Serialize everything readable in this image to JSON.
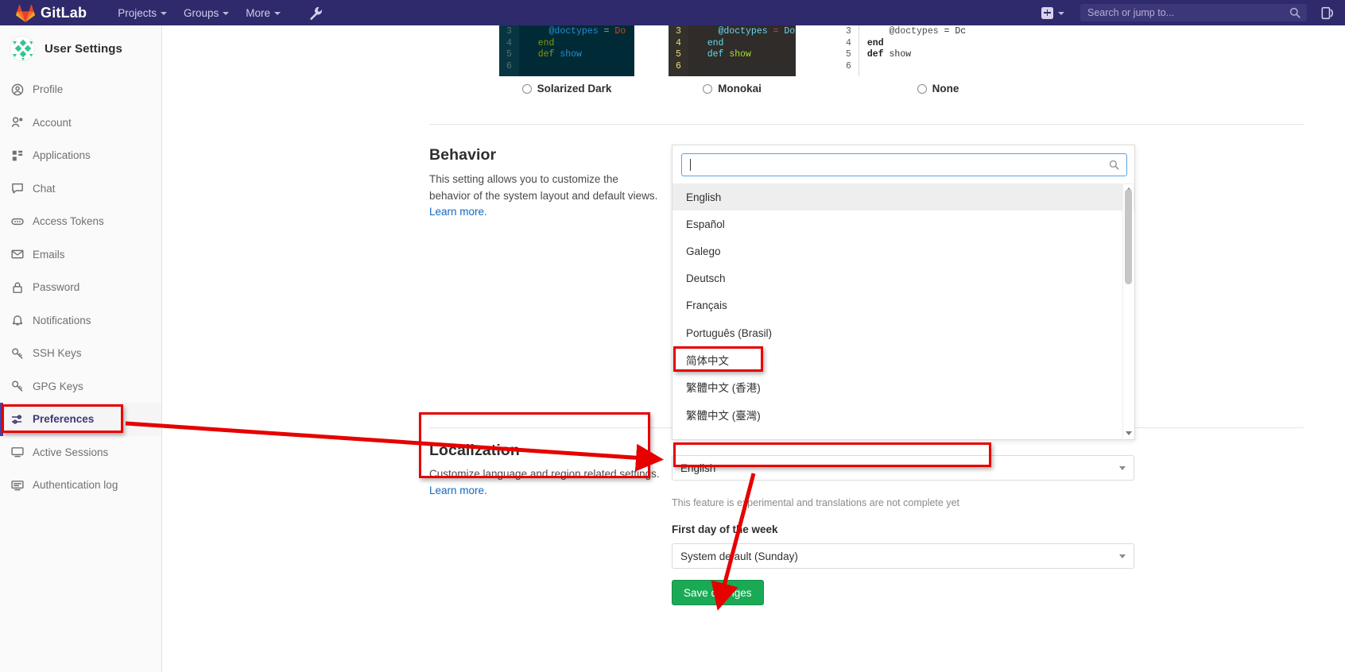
{
  "topnav": {
    "brand": "GitLab",
    "items": [
      {
        "label": "Projects"
      },
      {
        "label": "Groups"
      },
      {
        "label": "More"
      }
    ],
    "wrench_icon": "wrench-icon",
    "plus_icon": "plus-square-icon",
    "search_placeholder": "Search or jump to...",
    "search_icon": "search-icon",
    "user_icon": "user-avatar-icon"
  },
  "sidebar": {
    "title": "User Settings",
    "avatar_icon": "user-avatar-identicon",
    "items": [
      {
        "label": "Profile",
        "icon": "user-circle-icon",
        "active": false
      },
      {
        "label": "Account",
        "icon": "account-icon",
        "active": false
      },
      {
        "label": "Applications",
        "icon": "applications-icon",
        "active": false
      },
      {
        "label": "Chat",
        "icon": "chat-icon",
        "active": false
      },
      {
        "label": "Access Tokens",
        "icon": "token-icon",
        "active": false
      },
      {
        "label": "Emails",
        "icon": "envelope-icon",
        "active": false
      },
      {
        "label": "Password",
        "icon": "lock-icon",
        "active": false
      },
      {
        "label": "Notifications",
        "icon": "bell-icon",
        "active": false
      },
      {
        "label": "SSH Keys",
        "icon": "key-icon",
        "active": false
      },
      {
        "label": "GPG Keys",
        "icon": "key-icon",
        "active": false
      },
      {
        "label": "Preferences",
        "icon": "sliders-icon",
        "active": true
      },
      {
        "label": "Active Sessions",
        "icon": "monitor-icon",
        "active": false
      },
      {
        "label": "Authentication log",
        "icon": "log-icon",
        "active": false
      }
    ]
  },
  "themes": [
    {
      "name": "Solarized Dark",
      "bg": "#002b36",
      "gutter_bg": "#073642",
      "gutter_fg": "#586e75",
      "lines": [
        "3",
        "4",
        "5",
        "6"
      ],
      "code": [
        {
          "indent": "    ",
          "tokens": [
            {
              "t": "@doctypes",
              "c": "#268bd2"
            },
            {
              "t": " = ",
              "c": "#93a1a1"
            },
            {
              "t": "Do",
              "c": "#cb4b16"
            }
          ]
        },
        {
          "indent": "  ",
          "tokens": [
            {
              "t": "end",
              "c": "#859900"
            }
          ]
        },
        {
          "indent": "",
          "tokens": [
            {
              "t": "",
              "c": "#93a1a1"
            }
          ]
        },
        {
          "indent": "  ",
          "tokens": [
            {
              "t": "def ",
              "c": "#859900"
            },
            {
              "t": "show",
              "c": "#268bd2"
            }
          ]
        }
      ]
    },
    {
      "name": "Monokai",
      "bg": "#2f2c29",
      "gutter_bg": "#34312c",
      "gutter_fg": "#e6db74",
      "lines": [
        "3",
        "4",
        "5",
        "6"
      ],
      "code": [
        {
          "indent": "    ",
          "tokens": [
            {
              "t": "@doctypes",
              "c": "#66d9ef"
            },
            {
              "t": " = ",
              "c": "#f92672"
            },
            {
              "t": "Do",
              "c": "#66d9ef"
            }
          ]
        },
        {
          "indent": "  ",
          "tokens": [
            {
              "t": "end",
              "c": "#66d9ef"
            }
          ]
        },
        {
          "indent": "",
          "tokens": [
            {
              "t": "",
              "c": "#f8f8f2"
            }
          ]
        },
        {
          "indent": "  ",
          "tokens": [
            {
              "t": "def ",
              "c": "#66d9ef"
            },
            {
              "t": "show",
              "c": "#a6e22e"
            }
          ]
        }
      ]
    },
    {
      "name": "None",
      "bg": "#ffffff",
      "gutter_bg": "#ffffff",
      "gutter_fg": "#5c5c5c",
      "lines": [
        "3",
        "4",
        "5",
        "6"
      ],
      "code": [
        {
          "indent": "    ",
          "tokens": [
            {
              "t": "@doctypes",
              "c": "#4a4a4a"
            },
            {
              "t": " = ",
              "c": "#303030"
            },
            {
              "t": "Dc",
              "c": "#303030"
            }
          ]
        },
        {
          "indent": "",
          "tokens": [
            {
              "t": "end",
              "c": "#1f1f1f",
              "b": true
            }
          ]
        },
        {
          "indent": "",
          "tokens": [
            {
              "t": "",
              "c": "#303030"
            }
          ]
        },
        {
          "indent": "",
          "tokens": [
            {
              "t": "def ",
              "c": "#1f1f1f",
              "b": true
            },
            {
              "t": "show",
              "c": "#303030"
            }
          ]
        }
      ]
    }
  ],
  "behavior": {
    "title": "Behavior",
    "description": "This setting allows you to customize the behavior of the system layout and default views.",
    "learn_more": "Learn more."
  },
  "localization": {
    "title": "Localization",
    "description": "Customize language and region related settings.",
    "learn_more": "Learn more."
  },
  "dropdown": {
    "search_value": "",
    "search_icon": "search-icon",
    "scroll_up_icon": "chevron-up-icon",
    "scroll_down_icon": "chevron-down-icon",
    "options": [
      {
        "label": "English",
        "selected": true,
        "highlighted": false
      },
      {
        "label": "Español",
        "selected": false,
        "highlighted": false
      },
      {
        "label": "Galego",
        "selected": false,
        "highlighted": false
      },
      {
        "label": "Deutsch",
        "selected": false,
        "highlighted": false
      },
      {
        "label": "Français",
        "selected": false,
        "highlighted": false
      },
      {
        "label": "Português (Brasil)",
        "selected": false,
        "highlighted": false
      },
      {
        "label": "简体中文",
        "selected": false,
        "highlighted": true
      },
      {
        "label": "繁體中文 (香港)",
        "selected": false,
        "highlighted": false
      },
      {
        "label": "繁體中文 (臺灣)",
        "selected": false,
        "highlighted": false
      }
    ]
  },
  "form": {
    "language_value": "English",
    "language_help": "This feature is experimental and translations are not complete yet",
    "first_day_label": "First day of the week",
    "first_day_value": "System default (Sunday)",
    "save_label": "Save changes"
  },
  "colors": {
    "brand_navy": "#2f2a6b",
    "accent_purple": "#4b42a6",
    "link_blue": "#1068bf",
    "save_green": "#1aaa55",
    "annotation_red": "#e60000"
  }
}
